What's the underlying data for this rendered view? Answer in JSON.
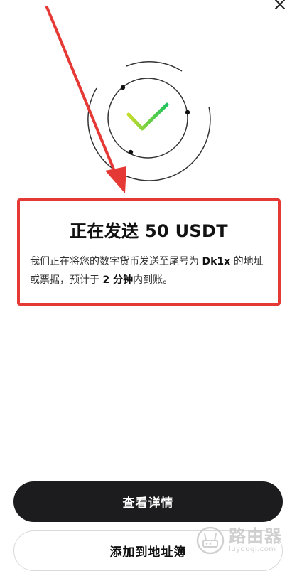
{
  "header": {
    "close_icon": "close-icon"
  },
  "status": {
    "title": "正在发送 50 USDT",
    "desc_before_address": "我们正在将您的数字货币发送至尾号为 ",
    "address_suffix": "Dk1x",
    "desc_after_address": " 的地址或票据，预计于 ",
    "eta": "2 分钟",
    "desc_end": "内到账。"
  },
  "actions": {
    "view_details_label": "查看详情",
    "add_to_address_book_label": "添加到地址簿"
  },
  "watermark": {
    "brand": "路由器",
    "site": "luyouqi.com"
  },
  "colors": {
    "primary_button": "#1c1c1e",
    "check_gradient_start": "#c6dc2b",
    "check_gradient_end": "#1ec45c",
    "annotation_red": "#e53935"
  }
}
